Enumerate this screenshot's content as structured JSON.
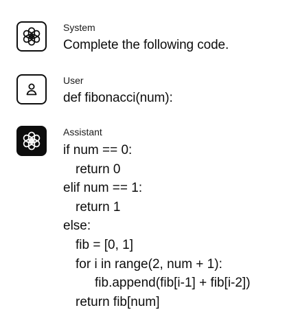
{
  "messages": {
    "system": {
      "role": "System",
      "icon": "openai-logo-icon",
      "text": "Complete the following code."
    },
    "user": {
      "role": "User",
      "icon": "user-icon",
      "text": "def fibonacci(num):"
    },
    "assistant": {
      "role": "Assistant",
      "icon": "openai-logo-icon",
      "lines": [
        "if num == 0:",
        "return 0",
        "elif num == 1:",
        "return 1",
        "else:",
        "fib = [0, 1]",
        "for i in range(2, num + 1):",
        "fib.append(fib[i-1] + fib[i-2])",
        "return fib[num]"
      ]
    }
  },
  "colors": {
    "text": "#0d0d0d",
    "background": "#ffffff",
    "assistant_avatar_bg": "#0d0d0d"
  }
}
